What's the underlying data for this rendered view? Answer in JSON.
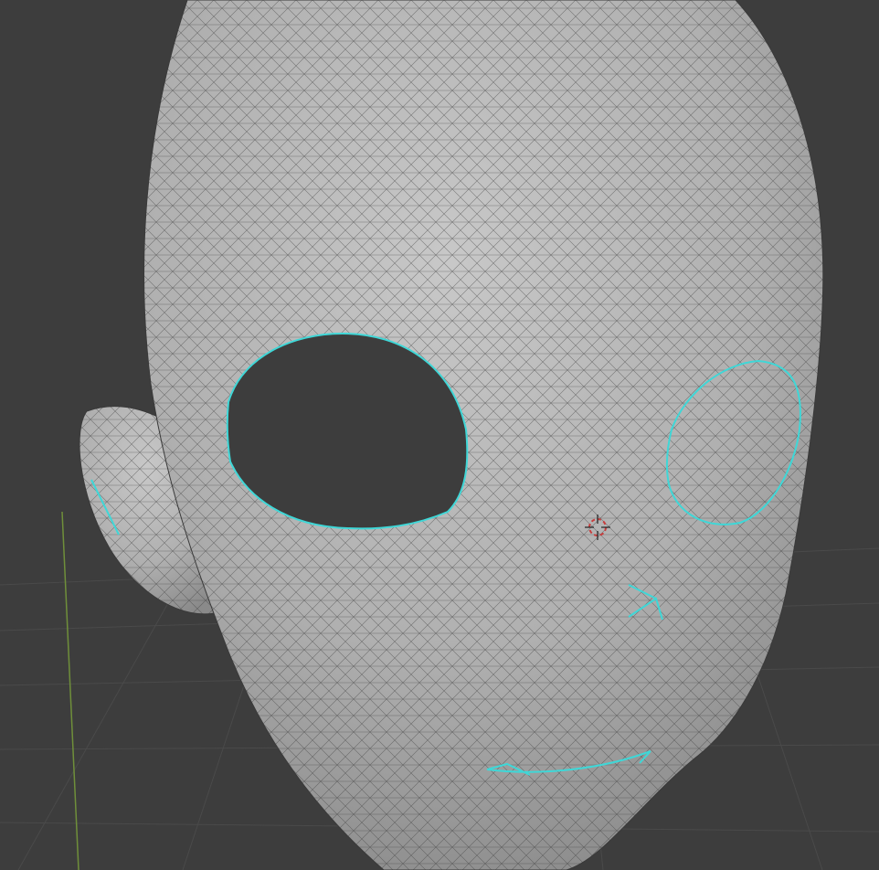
{
  "viewport": {
    "background_color": "#3d3d3d",
    "grid_line_color": "#4a4a4a",
    "y_axis_color": "#6f8f3a",
    "mesh_fill_color": "#b6b6b6",
    "wire_color": "#3a3a3a",
    "boundary_edge_color": "#3fd7d7",
    "cursor_color": "#c83c3c",
    "icons": [
      "3d-cursor-icon"
    ]
  }
}
